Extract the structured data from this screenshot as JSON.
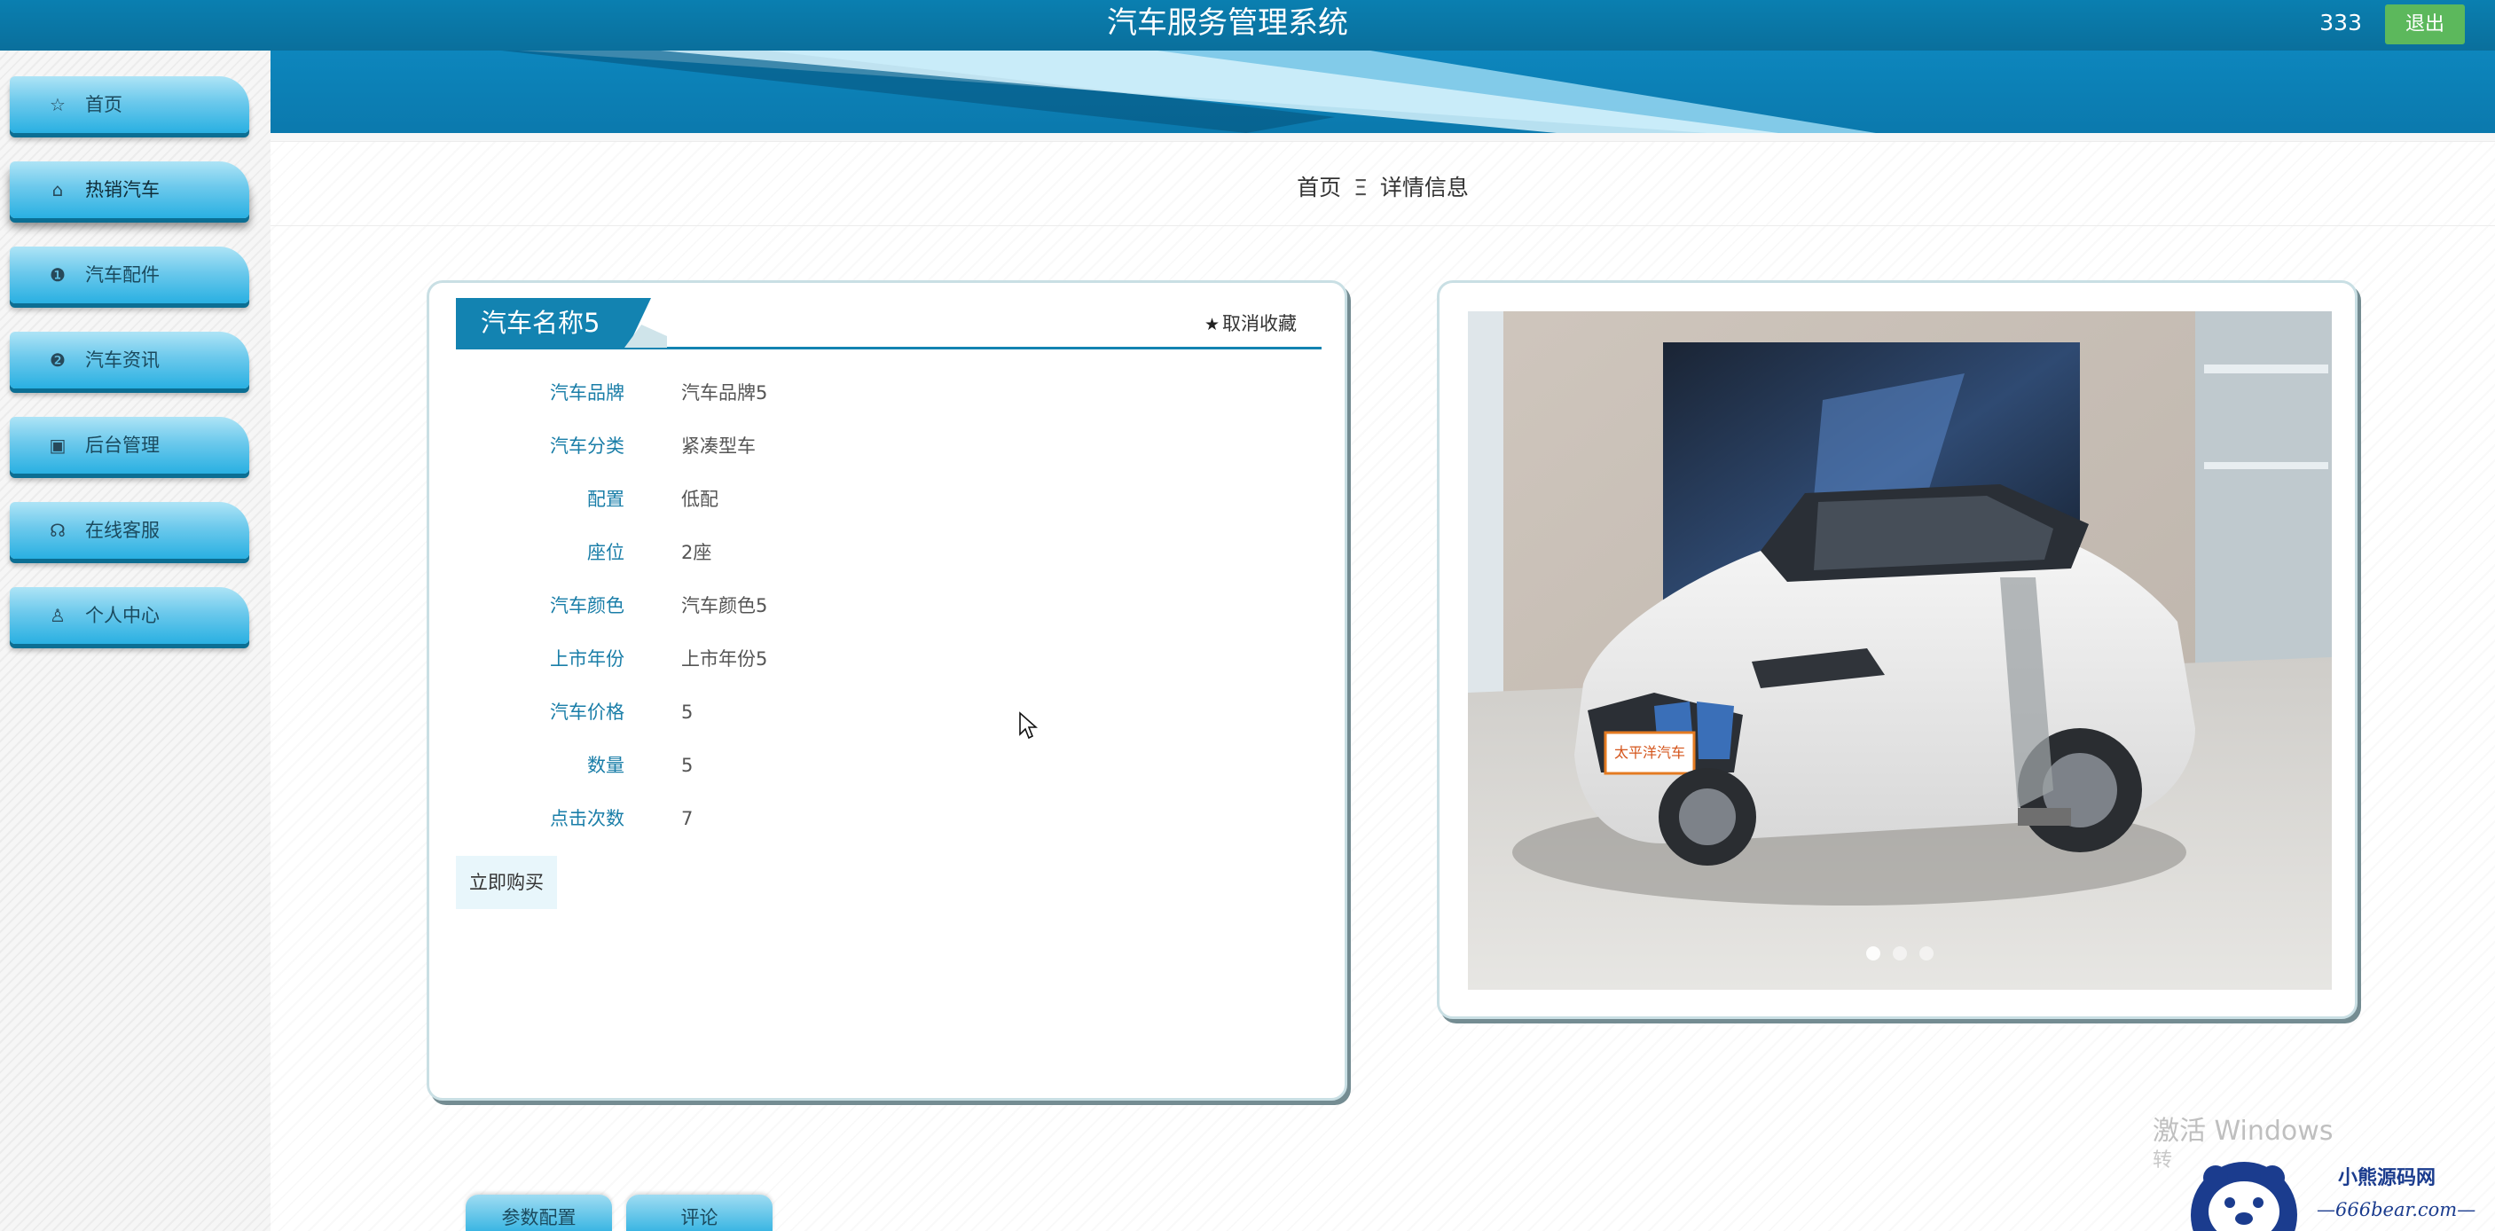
{
  "header": {
    "title": "汽车服务管理系统",
    "user": "333",
    "logout_label": "退出"
  },
  "sidebar": {
    "items": [
      {
        "label": "首页",
        "icon": "star-outline-icon",
        "glyph": "☆"
      },
      {
        "label": "热销汽车",
        "icon": "shopping-bag-icon",
        "glyph": "⌂"
      },
      {
        "label": "汽车配件",
        "icon": "exclamation-circle-icon",
        "glyph": "❶"
      },
      {
        "label": "汽车资讯",
        "icon": "question-circle-icon",
        "glyph": "❷"
      },
      {
        "label": "后台管理",
        "icon": "box-icon",
        "glyph": "▣"
      },
      {
        "label": "在线客服",
        "icon": "headset-icon",
        "glyph": "☊"
      },
      {
        "label": "个人中心",
        "icon": "user-icon",
        "glyph": "♙"
      }
    ]
  },
  "breadcrumb": {
    "home": "首页",
    "separator": "Ξ",
    "current": "详情信息"
  },
  "detail": {
    "title": "汽车名称5",
    "favorite_label": "取消收藏",
    "fields": [
      {
        "label": "汽车品牌",
        "value": "汽车品牌5"
      },
      {
        "label": "汽车分类",
        "value": "紧凑型车"
      },
      {
        "label": "配置",
        "value": "低配"
      },
      {
        "label": "座位",
        "value": "2座"
      },
      {
        "label": "汽车颜色",
        "value": "汽车颜色5"
      },
      {
        "label": "上市年份",
        "value": "上市年份5"
      },
      {
        "label": "汽车价格",
        "value": "5"
      },
      {
        "label": "数量",
        "value": "5"
      },
      {
        "label": "点击次数",
        "value": "7"
      }
    ],
    "buy_label": "立即购买"
  },
  "tabs": [
    "参数配置",
    "评论"
  ],
  "watermarks": {
    "windows": "激活 Windows",
    "windows_sub": "转",
    "site_name": "小熊源码网",
    "site_url": "—666bear.com—"
  },
  "colors": {
    "header_bg": "#0a7fb0",
    "accent": "#1383b1",
    "logout_bg": "#5cb85c",
    "label_color": "#1a7ea8"
  }
}
